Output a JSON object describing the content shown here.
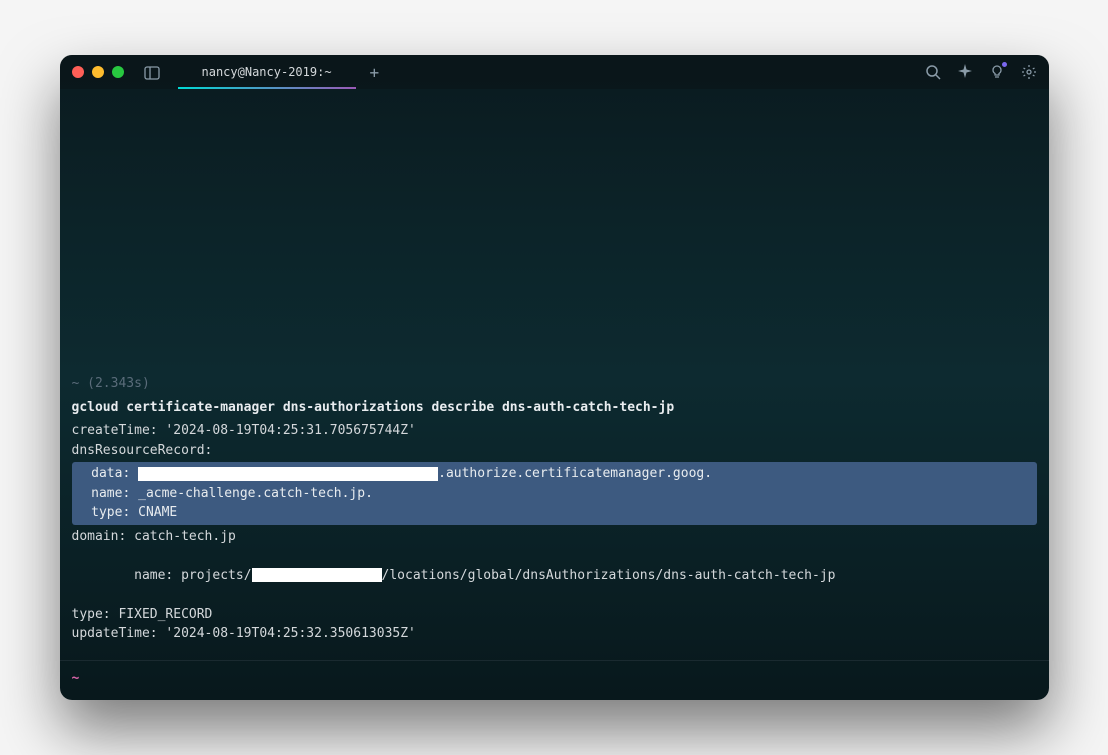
{
  "window": {
    "tab_title": "nancy@Nancy-2019:~"
  },
  "prompt": {
    "path_and_time": "~ (2.343s)",
    "command": "gcloud certificate-manager dns-authorizations describe dns-auth-catch-tech-jp"
  },
  "output": {
    "createTime": "createTime: '2024-08-19T04:25:31.705675744Z'",
    "dnsResourceRecord": "dnsResourceRecord:",
    "data_prefix": "  data: ",
    "data_suffix": ".authorize.certificatemanager.goog.",
    "name_line": "  name: _acme-challenge.catch-tech.jp.",
    "type_line": "  type: CNAME",
    "domain": "domain: catch-tech.jp",
    "name_prefix": "name: projects/",
    "name_suffix": "/locations/global/dnsAuthorizations/dns-auth-catch-tech-jp",
    "type": "type: FIXED_RECORD",
    "updateTime": "updateTime: '2024-08-19T04:25:32.350613035Z'"
  },
  "new_prompt": {
    "tilde": "~"
  }
}
